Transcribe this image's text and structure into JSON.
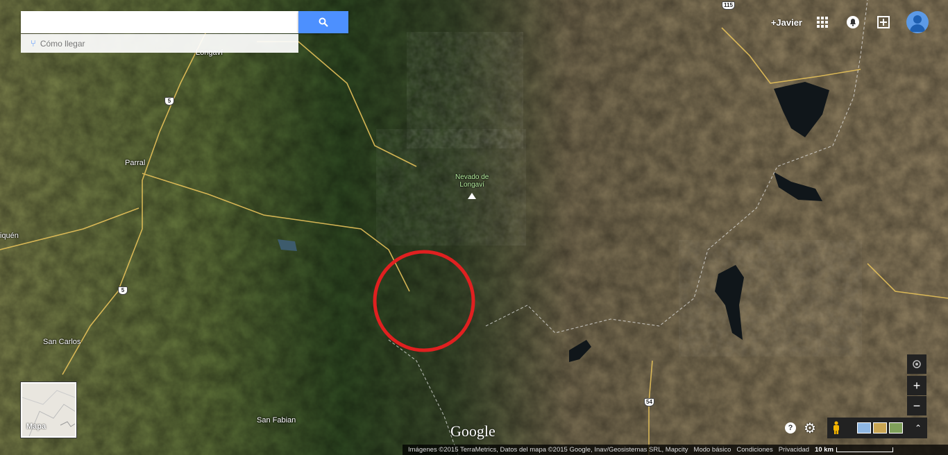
{
  "search": {
    "placeholder": "",
    "value": ""
  },
  "directions_label": "Cómo llegar",
  "user": "+Javier",
  "places": {
    "longavi_top": "Longaví",
    "parral": "Parral",
    "nevado_line1": "Nevado de",
    "nevado_line2": "Longaví",
    "san_carlos": "San Carlos",
    "san_fabian": "San Fabian",
    "niquen": "iquén"
  },
  "routes": {
    "r5a": "5",
    "r5b": "5",
    "r115": "115",
    "r54": "54"
  },
  "map_toggle_label": "Mapa",
  "logo_text": "Google",
  "footer": {
    "imagery": "Imágenes ©2015 TerraMetrics, Datos del mapa ©2015 Google, Inav/Geosistemas SRL, Mapcity",
    "basic_mode": "Modo básico",
    "terms": "Condiciones",
    "privacy": "Privacidad",
    "scale": "10 km"
  },
  "annotation": {
    "color": "#e02020"
  },
  "colors": {
    "accent": "#4d90fe"
  },
  "icons": [
    "search-icon",
    "apps-grid-icon",
    "notifications-icon",
    "share-plus-icon",
    "avatar-icon",
    "directions-icon",
    "locate-icon",
    "zoom-in-icon",
    "zoom-out-icon",
    "pegman-icon",
    "help-icon",
    "gear-icon",
    "expand-icon"
  ]
}
